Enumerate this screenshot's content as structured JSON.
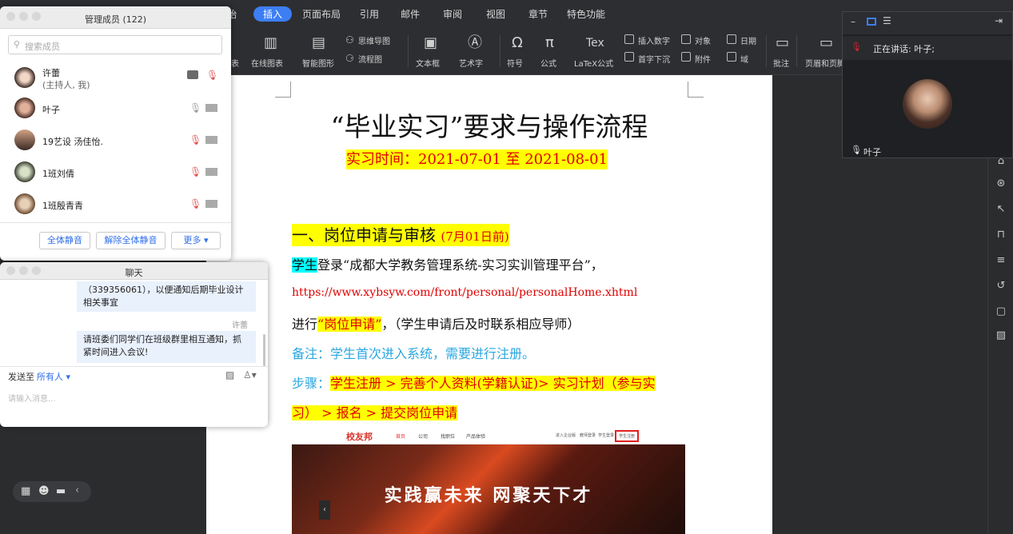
{
  "ribbon": {
    "tabs": [
      "始",
      "插入",
      "页面布局",
      "引用",
      "邮件",
      "审阅",
      "视图",
      "章节",
      "特色功能"
    ],
    "tools": {
      "chart_partial": "表",
      "online_chart": "在线图表",
      "smart_shape": "智能图形",
      "mindmap": "思维导图",
      "flowchart": "流程图",
      "textbox": "文本框",
      "wordart": "艺术字",
      "symbol": "符号",
      "formula": "公式",
      "latex": "LaTeX公式",
      "insert_number": "插入数字",
      "dropcap": "首字下沉",
      "object": "对象",
      "attachment": "附件",
      "date": "日期",
      "field": "域",
      "comment": "批注",
      "header_footer": "页眉和页脚"
    }
  },
  "document": {
    "title": "“毕业实习”要求与操作流程",
    "time": "实习时间：2021-07-01 至 2021-08-01",
    "section1_title": "一、岗位申请与审核",
    "section1_date": "(7月01日前)",
    "student": "学生",
    "login_text": "登录“成都大学教务管理系统-实习实训管理平台”，",
    "url": "https://www.xybsyw.com/front/personal/personalHome.xhtml",
    "proceed": "进行",
    "apply": "“岗位申请”",
    "apply_after": "，（学生申请后及时联系相应导师）",
    "note": "备注：学生首次进入系统，需要进行注册。",
    "steps_label": "步骤：",
    "steps_1": "学生注册 > 完善个人资料(学籍认证)> 实习计划（参与实",
    "steps_2": "习） > 报名 > 提交岗位申请",
    "banner_logo": "校友邦",
    "banner_nav": [
      "首页",
      "公司",
      "找职位",
      "产品体验"
    ],
    "banner_right": [
      "进入企业版",
      "教师登录",
      "学生登录",
      "学生注册"
    ],
    "banner_slogan": "实践赢未来 网聚天下才"
  },
  "video": {
    "speaking": "正在讲话: 叶子;",
    "name": "叶子"
  },
  "members": {
    "title": "管理成员 (122)",
    "search_placeholder": "搜索成员",
    "list": [
      {
        "name": "许蕾",
        "sub": "(主持人, 我)"
      },
      {
        "name": "叶子"
      },
      {
        "name": "19艺设 汤佳怡."
      },
      {
        "name": "1班刘倩"
      },
      {
        "name": "1班殷青青"
      }
    ],
    "mute_all": "全体静音",
    "unmute_all": "解除全体静音",
    "more": "更多 ▾"
  },
  "chat": {
    "title": "聊天",
    "msg1": "（339356061），以便通知后期毕业设计相关事宜",
    "sender": "许蕾",
    "msg2": "请班委们同学们在班级群里相互通知，抓紧时间进入会议!",
    "send_to_label": "发送至",
    "send_to": "所有人 ▾",
    "input_placeholder": "请输入消息..."
  },
  "colors": {
    "accent": "#3d7ef5",
    "highlight_yellow": "#ffff00",
    "highlight_cyan": "#00ffff",
    "red_text": "#e00000",
    "note_blue": "#2aa7e0"
  }
}
